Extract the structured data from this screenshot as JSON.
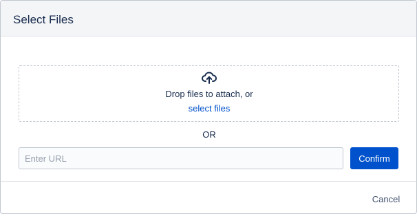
{
  "dialog": {
    "title": "Select Files"
  },
  "dropzone": {
    "icon": "cloud-upload-icon",
    "text": "Drop files to attach, or",
    "link_label": "select files"
  },
  "separator": {
    "label": "OR"
  },
  "url_input": {
    "placeholder": "Enter URL",
    "value": ""
  },
  "buttons": {
    "confirm_label": "Confirm",
    "cancel_label": "Cancel"
  },
  "colors": {
    "primary": "#0052cc",
    "header_bg": "#f4f5f7",
    "text": "#172b4d",
    "border": "#c1c7d0",
    "placeholder": "#97a0af"
  }
}
